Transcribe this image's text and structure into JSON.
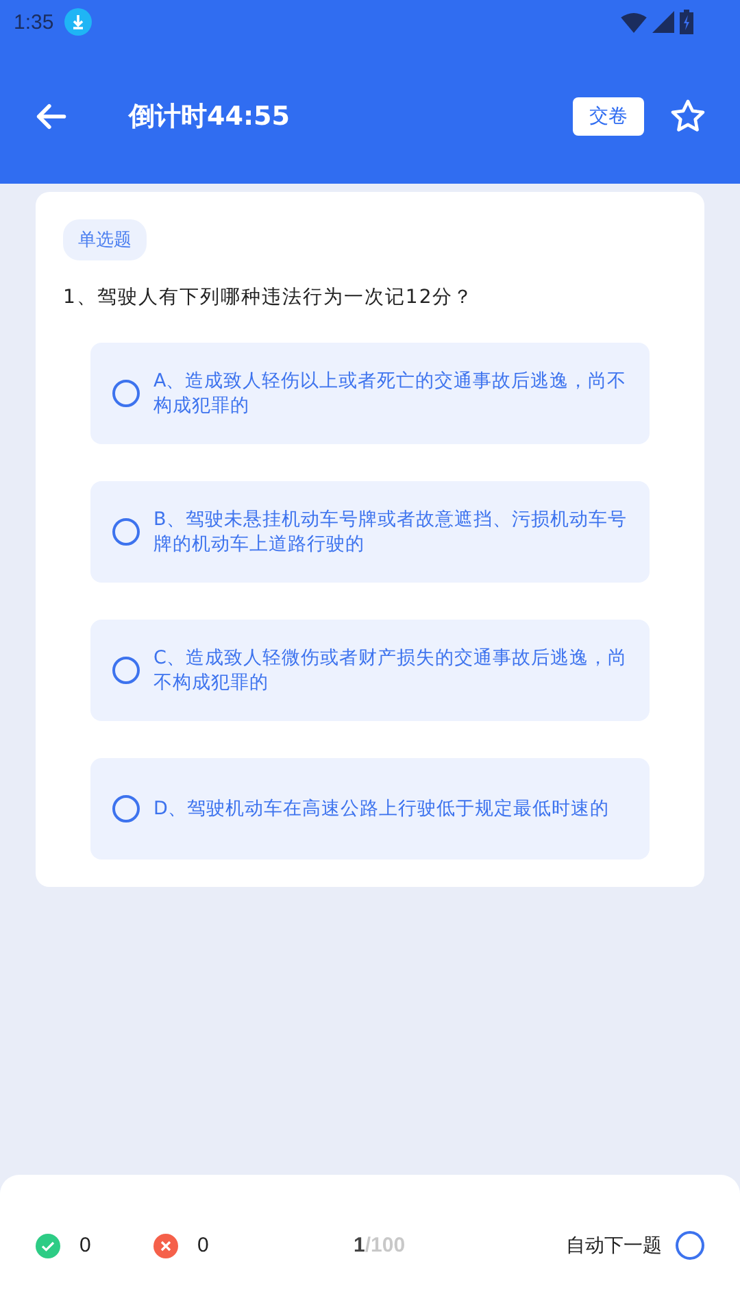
{
  "status_bar": {
    "time": "1:35"
  },
  "header": {
    "title": "倒计时44:55",
    "submit_button": "交卷",
    "favorite": false
  },
  "question": {
    "type_tag": "单选题",
    "text": "1、驾驶人有下列哪种违法行为一次记12分？",
    "options": [
      {
        "text": "A、造成致人轻伤以上或者死亡的交通事故后逃逸，尚不构成犯罪的",
        "selected": false
      },
      {
        "text": "B、驾驶未悬挂机动车号牌或者故意遮挡、污损机动车号牌的机动车上道路行驶的",
        "selected": false
      },
      {
        "text": "C、造成致人轻微伤或者财产损失的交通事故后逃逸，尚不构成犯罪的",
        "selected": false
      },
      {
        "text": "D、驾驶机动车在高速公路上行驶低于规定最低时速的",
        "selected": false
      }
    ]
  },
  "footer": {
    "correct_count": "0",
    "wrong_count": "0",
    "current": "1",
    "total": "/100",
    "auto_next_label": "自动下一题",
    "auto_next": false
  }
}
